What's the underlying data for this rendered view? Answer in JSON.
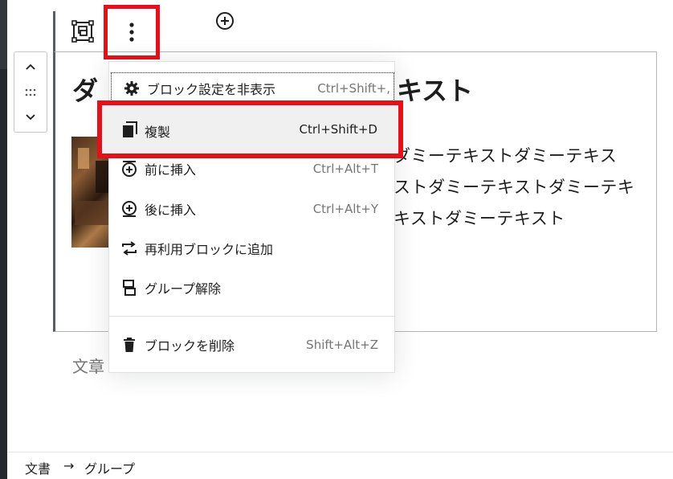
{
  "block_toolbar": {
    "group_icon": "group-block-icon",
    "more_icon": "vertical-ellipsis-icon",
    "add_icon": "plus-circle-icon"
  },
  "mover": {
    "up_icon": "chevron-up-icon",
    "drag_icon": "drag-handle-icon",
    "down_icon": "chevron-down-icon"
  },
  "content": {
    "heading_start": "ダ",
    "heading_end": "キスト",
    "paragraph_lines": [
      "ダミーテキストダミーテキス",
      "ストダミーテキストダミーテキ",
      "キストダミーテキスト"
    ],
    "below_text": "文章",
    "below_text_tail": ","
  },
  "menu": {
    "items": [
      {
        "label": "ブロック設定を非表示",
        "shortcut": "Ctrl+Shift+,",
        "icon": "gear-icon"
      },
      {
        "label": "複製",
        "shortcut": "Ctrl+Shift+D",
        "icon": "duplicate-icon"
      },
      {
        "label": "前に挿入",
        "shortcut": "Ctrl+Alt+T",
        "icon": "insert-before-icon"
      },
      {
        "label": "後に挿入",
        "shortcut": "Ctrl+Alt+Y",
        "icon": "insert-after-icon"
      },
      {
        "label": "再利用ブロックに追加",
        "shortcut": "",
        "icon": "reusable-block-icon"
      },
      {
        "label": "グループ解除",
        "shortcut": "",
        "icon": "ungroup-icon"
      },
      {
        "label": "ブロックを削除",
        "shortcut": "Shift+Alt+Z",
        "icon": "trash-icon"
      }
    ]
  },
  "breadcrumb": {
    "root": "文書",
    "arrow": "→",
    "current": "グループ"
  },
  "colors": {
    "highlight": "#e2121d",
    "block_border": "#555d66"
  }
}
